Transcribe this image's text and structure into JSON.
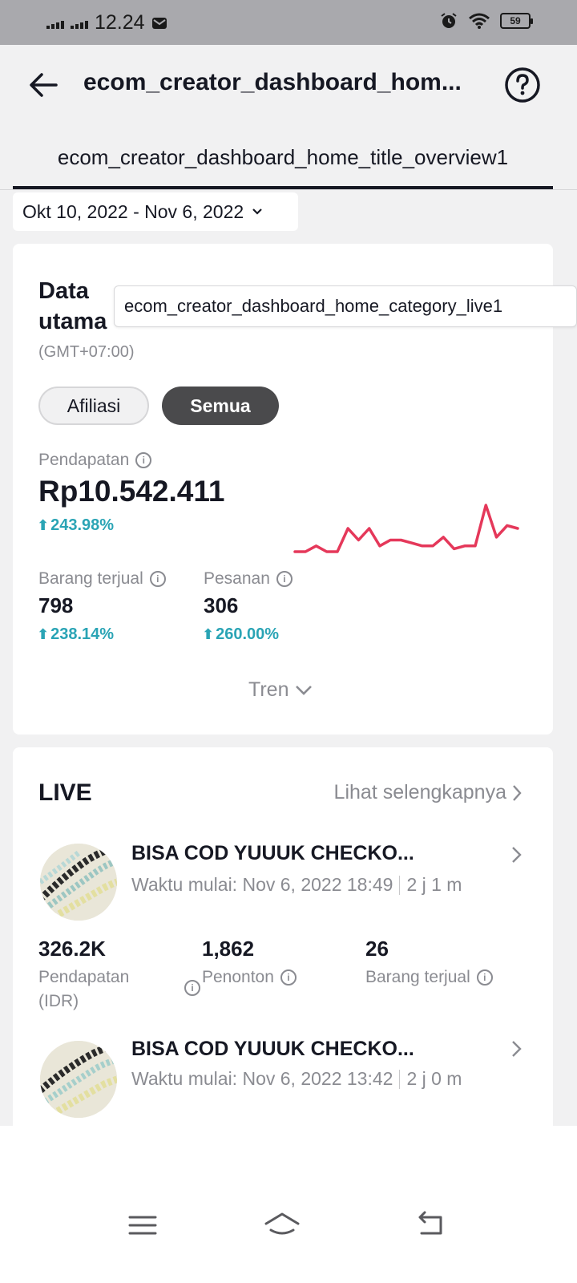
{
  "status_bar": {
    "time": "12.24",
    "battery": "59"
  },
  "header": {
    "title": "ecom_creator_dashboard_hom...",
    "tab_label": "ecom_creator_dashboard_home_title_overview1"
  },
  "date_range": "Okt 10, 2022 - Nov 6, 2022",
  "overview": {
    "section_title": "Data utama",
    "category_popup": "ecom_creator_dashboard_home_category_live1",
    "timezone": "(GMT+07:00)",
    "filters": [
      {
        "label": "Afiliasi"
      },
      {
        "label": "Semua"
      }
    ],
    "selected_filter": "Semua",
    "revenue": {
      "label": "Pendapatan",
      "value": "Rp10.542.411",
      "change": "243.98%"
    },
    "items_sold": {
      "label": "Barang terjual",
      "value": "798",
      "change": "238.14%"
    },
    "orders": {
      "label": "Pesanan",
      "value": "306",
      "change": "260.00%"
    },
    "trend_label": "Tren",
    "sparkline": [
      1,
      1,
      2,
      1,
      1,
      5,
      3,
      5,
      2,
      3,
      3,
      2.5,
      2,
      2,
      3.5,
      1.5,
      2,
      2,
      9,
      3.5,
      5.5,
      5
    ],
    "line_color": "#e5385a",
    "up_color": "#2aa4b5"
  },
  "live": {
    "title": "LIVE",
    "see_more": "Lihat selengkapnya",
    "streams": [
      {
        "title": "BISA COD YUUUK CHECKO...",
        "start": "Waktu mulai: Nov 6, 2022 18:49",
        "duration": "2 j 1 m",
        "stats": [
          {
            "value": "326.2K",
            "label": "Pendapatan (IDR)"
          },
          {
            "value": "1,862",
            "label": "Penonton"
          },
          {
            "value": "26",
            "label": "Barang terjual"
          }
        ]
      },
      {
        "title": "BISA COD YUUUK CHECKO...",
        "start": "Waktu mulai: Nov 6, 2022 13:42",
        "duration": "2 j 0 m"
      }
    ]
  }
}
